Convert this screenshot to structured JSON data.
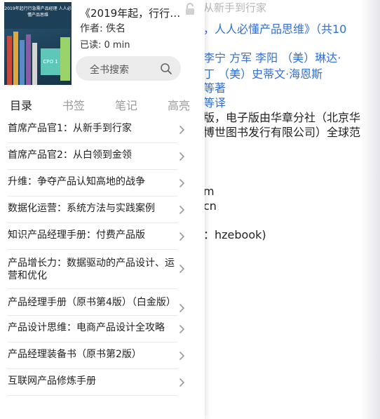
{
  "reader": {
    "lines": [
      {
        "text": "从新手到行家",
        "style": "faded"
      },
      {
        "text": "，人人必懂产品思维》（共10",
        "style": "link"
      },
      {
        "text": "李宁   方军   李阳   （美）琳达·",
        "style": "link"
      },
      {
        "text": "丁   （美）史蒂文·海恩斯",
        "style": "link"
      },
      {
        "text": "等著",
        "style": "link"
      },
      {
        "text": "   等译",
        "style": "link"
      },
      {
        "text": "版，电子版由华章分社（北京华",
        "style": "plain"
      },
      {
        "text": "博世图书发行有限公司）全球范",
        "style": "plain"
      },
      {
        "text": "m",
        "style": "plain"
      },
      {
        "text": "cn",
        "style": "plain"
      },
      {
        "text": "：hzebook)",
        "style": "plain"
      }
    ]
  },
  "drawer": {
    "book": {
      "title": "《2019年起，行行急…",
      "author": "作者: 佚名",
      "read": "已读:  0   min",
      "cover_text": "2019年起行行急需产品经理 人人必懂产品思维",
      "cover_badge": "CPO 1"
    },
    "search": {
      "label": "全书搜索"
    },
    "tabs": [
      {
        "label": "目录",
        "active": true
      },
      {
        "label": "书签",
        "active": false
      },
      {
        "label": "笔记",
        "active": false
      },
      {
        "label": "高亮",
        "active": false
      }
    ],
    "toc": [
      "首席产品官1：从新手到行家",
      "首席产品官2：从白领到金领",
      "升维：争夺产品认知高地的战争",
      "数据化运营：系统方法与实践案例",
      "知识产品经理手册：付费产品版",
      "产品增长力：数据驱动的产品设计、运营和优化",
      "产品经理手册（原书第4版）（白金版）",
      "产品设计思维：电商产品设计全攻略",
      "产品经理装备书（原书第2版）",
      "互联网产品修炼手册"
    ]
  },
  "colors": {
    "link": "#2f6fd6",
    "active_tab": "#222222",
    "inactive_tab": "#9a9a9a"
  }
}
